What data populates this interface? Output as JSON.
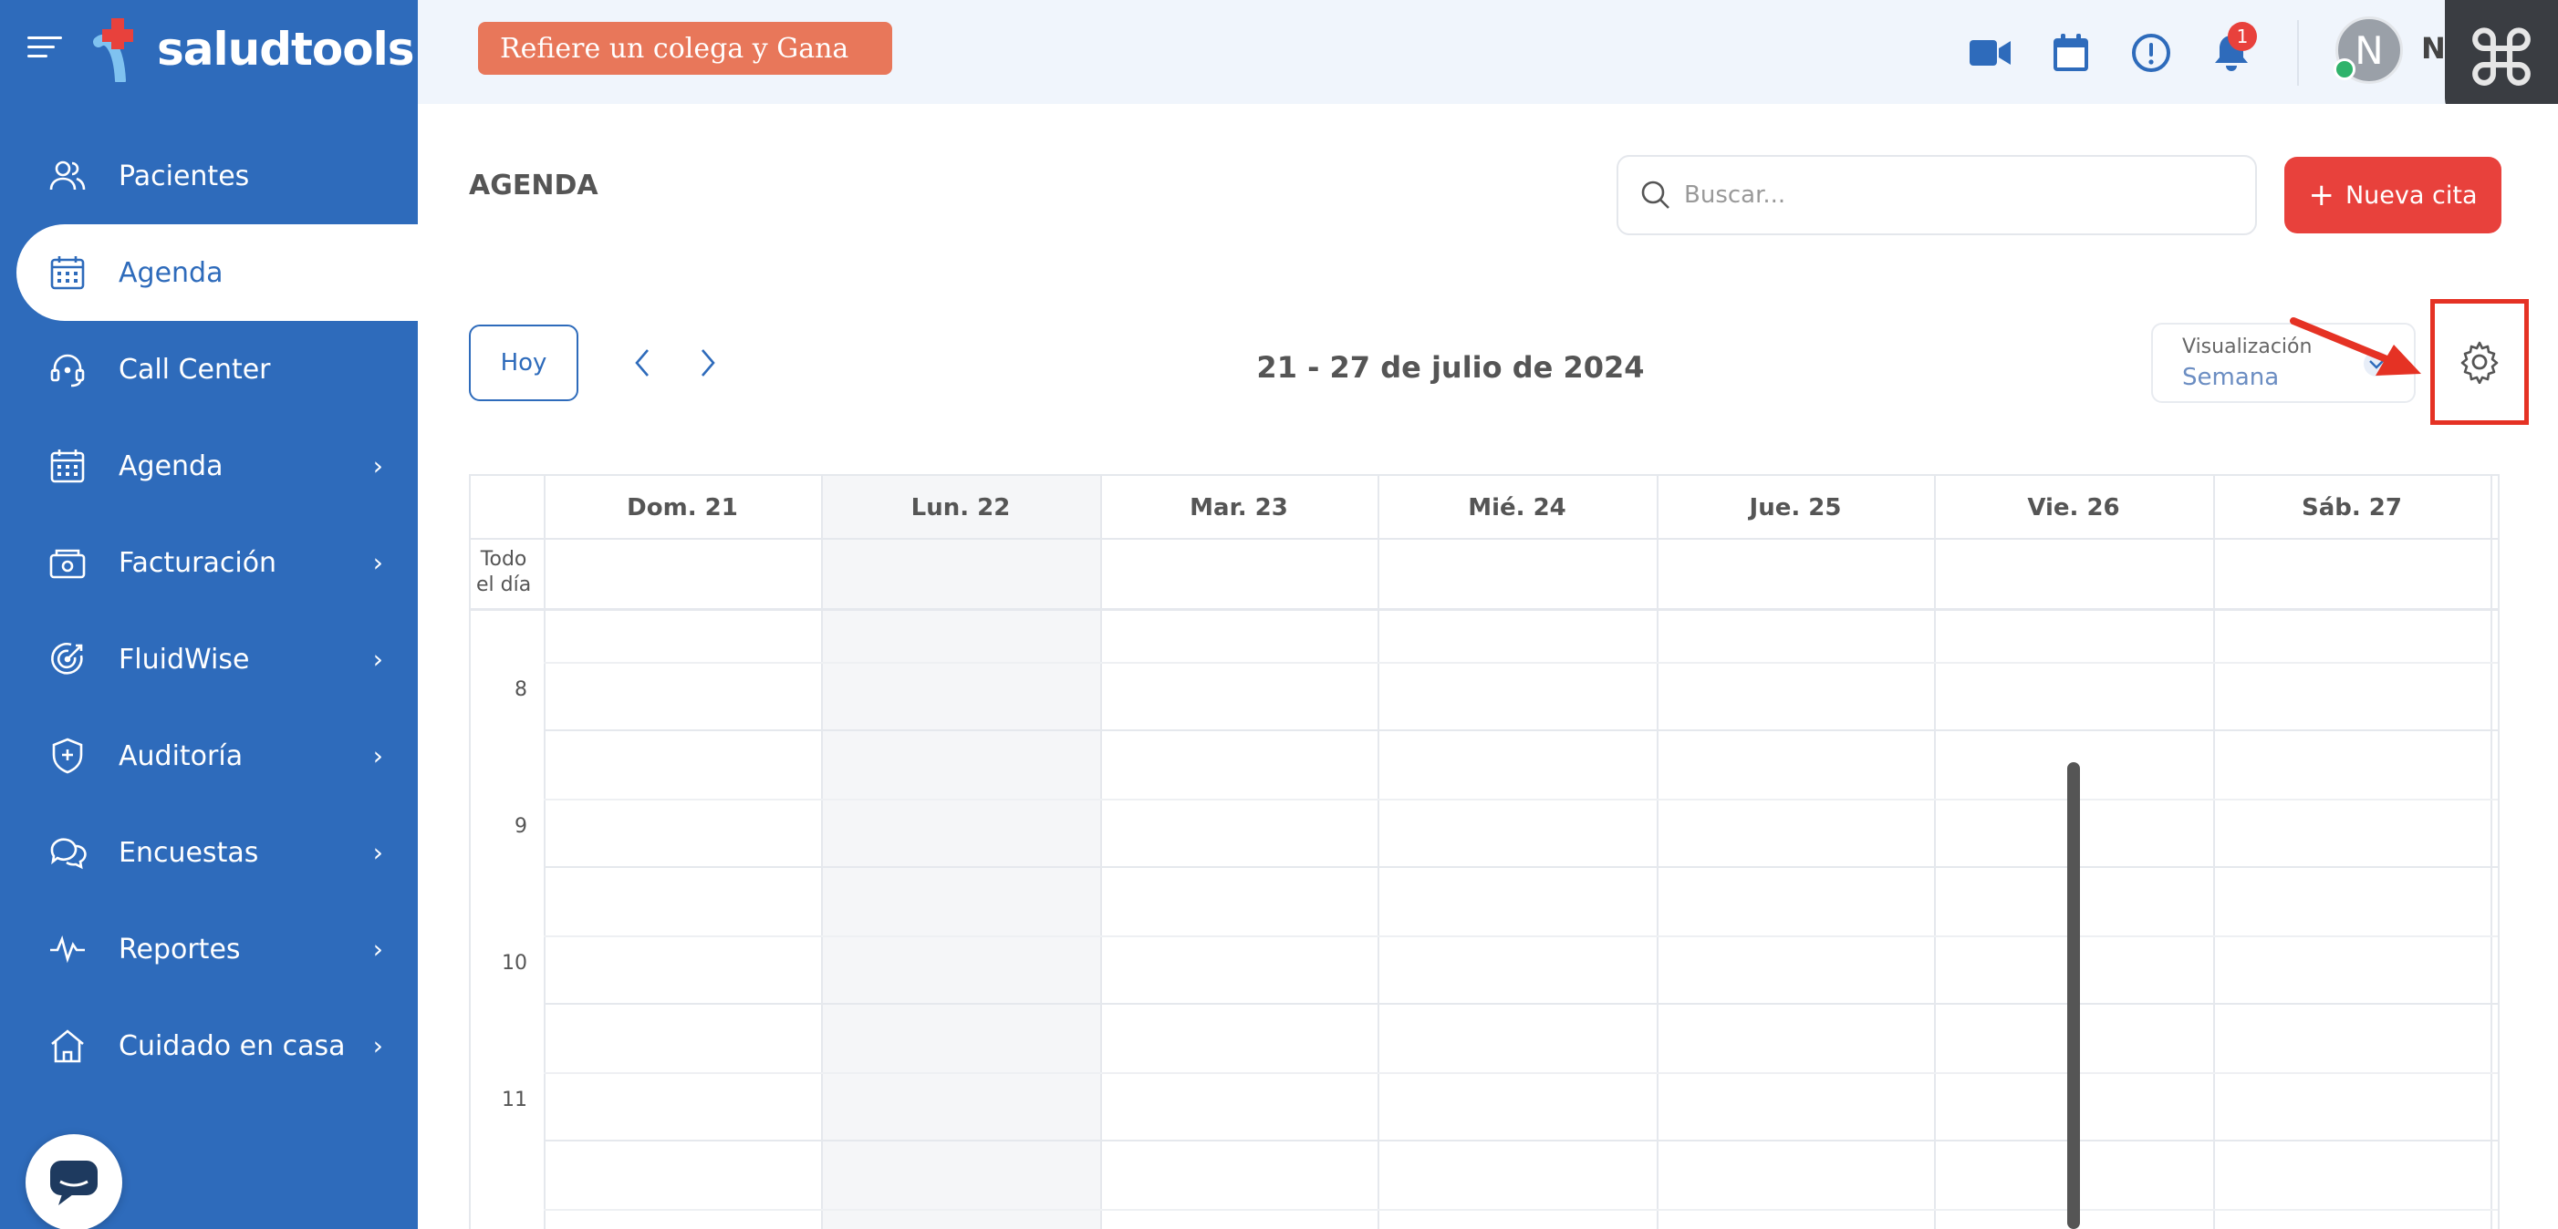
{
  "brand": {
    "name": "saludtools"
  },
  "sidebar": {
    "items": [
      {
        "label": "Pacientes",
        "icon": "patients-icon",
        "has_submenu": false,
        "active": false
      },
      {
        "label": "Agenda",
        "icon": "calendar-icon",
        "has_submenu": false,
        "active": true
      },
      {
        "label": "Call Center",
        "icon": "headset-icon",
        "has_submenu": false,
        "active": false
      },
      {
        "label": "Agenda",
        "icon": "calendar-icon",
        "has_submenu": true,
        "active": false
      },
      {
        "label": "Facturación",
        "icon": "billing-icon",
        "has_submenu": true,
        "active": false
      },
      {
        "label": "FluidWise",
        "icon": "target-icon",
        "has_submenu": true,
        "active": false
      },
      {
        "label": "Auditoría",
        "icon": "shield-plus-icon",
        "has_submenu": true,
        "active": false
      },
      {
        "label": "Encuestas",
        "icon": "chat-bubbles-icon",
        "has_submenu": true,
        "active": false
      },
      {
        "label": "Reportes",
        "icon": "pulse-icon",
        "has_submenu": true,
        "active": false
      },
      {
        "label": "Cuidado en casa",
        "icon": "home-icon",
        "has_submenu": true,
        "active": false
      }
    ]
  },
  "topbar": {
    "referral_label": "Refiere un colega y Gana",
    "notification_count": "1",
    "avatar_initial": "N",
    "username": "N"
  },
  "main": {
    "title": "AGENDA",
    "search_placeholder": "Buscar...",
    "new_appointment_label": "Nueva cita",
    "today_label": "Hoy",
    "date_range": "21 - 27 de julio de 2024",
    "view_label": "Visualización",
    "view_value": "Semana"
  },
  "calendar": {
    "days": [
      "Dom. 21",
      "Lun. 22",
      "Mar. 23",
      "Mié. 24",
      "Jue. 25",
      "Vie. 26",
      "Sáb. 27"
    ],
    "today_index": 1,
    "all_day_label_line1": "Todo",
    "all_day_label_line2": "el día",
    "hours": [
      "8",
      "9",
      "10",
      "11"
    ]
  },
  "colors": {
    "sidebar": "#2e6bbb",
    "accent_red": "#e8413c",
    "referral_orange": "#e8775a",
    "highlight_box": "#e53224"
  }
}
